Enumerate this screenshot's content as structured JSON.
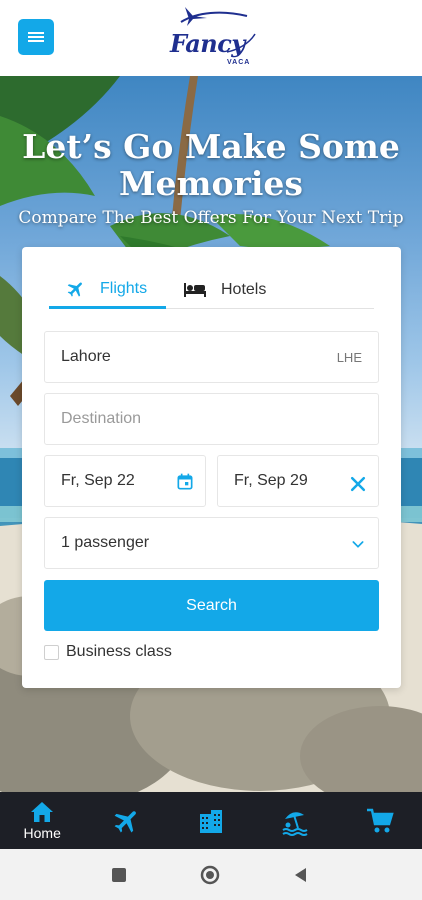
{
  "header": {
    "logo_text": "Fancy",
    "logo_subtext": "VACA",
    "menu_icon": "hamburger-menu-icon"
  },
  "hero": {
    "title": "Let’s Go Make Some Memories",
    "subtitle": "Compare The Best Offers For Your Next Trip"
  },
  "search_form": {
    "tabs": [
      {
        "label": "Flights",
        "icon": "airplane-icon",
        "active": true
      },
      {
        "label": "Hotels",
        "icon": "bed-icon",
        "active": false
      }
    ],
    "origin": {
      "value": "Lahore",
      "code": "LHE"
    },
    "destination": {
      "placeholder": "Destination"
    },
    "departure": {
      "value": "Fr, Sep 22",
      "icon": "calendar-icon"
    },
    "return": {
      "value": "Fr, Sep 29",
      "icon": "close-icon"
    },
    "passengers": {
      "value": "1 passenger",
      "icon": "chevron-down-icon"
    },
    "search_label": "Search",
    "business_class_label": "Business class"
  },
  "bottom_nav": {
    "items": [
      {
        "label": "Home",
        "icon": "home-icon"
      },
      {
        "label": "",
        "icon": "airplane-icon"
      },
      {
        "label": "",
        "icon": "hotel-building-icon"
      },
      {
        "label": "",
        "icon": "beach-umbrella-icon"
      },
      {
        "label": "",
        "icon": "cart-icon"
      }
    ]
  },
  "colors": {
    "accent": "#13a8e8",
    "nav_background": "#1d1f26",
    "logo": "#1f2f8f"
  }
}
